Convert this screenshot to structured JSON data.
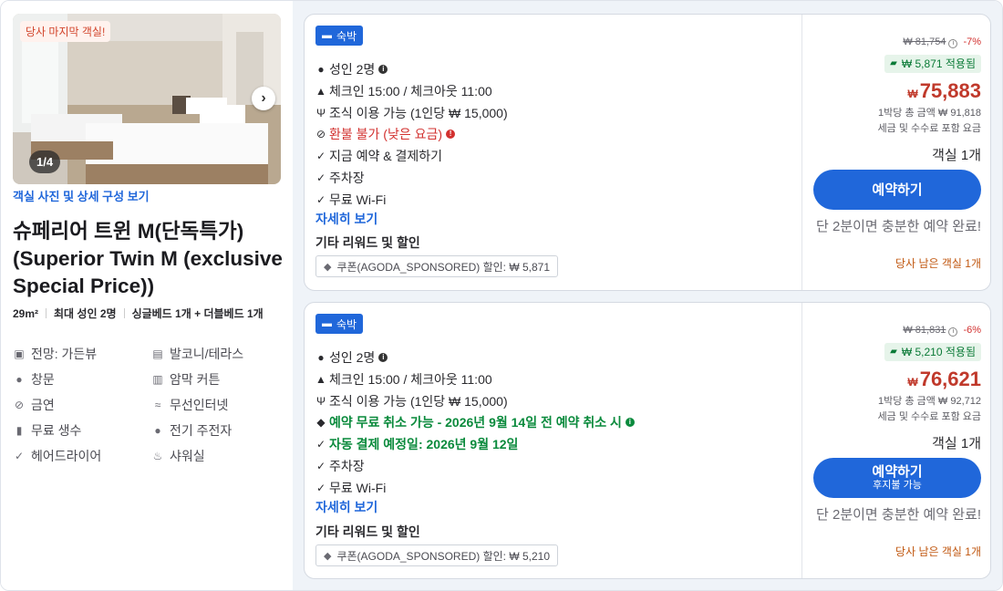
{
  "room": {
    "last_room_tag": "당사 마지막 객실!",
    "photo_counter": "1/4",
    "view_photos_link": "객실 사진 및 상세 구성 보기",
    "title": "슈페리어 트윈 M(단독특가) (Superior Twin M (exclusive Special Price))",
    "specs": {
      "size": "29m²",
      "occupancy": "최대 성인 2명",
      "beds": "싱글베드 1개 + 더블베드 1개"
    },
    "amenities": [
      {
        "icon": "view-icon",
        "label": "전망: 가든뷰"
      },
      {
        "icon": "balcony-icon",
        "label": "발코니/테라스"
      },
      {
        "icon": "window-icon",
        "label": "창문"
      },
      {
        "icon": "curtain-icon",
        "label": "암막 커튼"
      },
      {
        "icon": "no-smoking-icon",
        "label": "금연"
      },
      {
        "icon": "wifi-icon",
        "label": "무선인터넷"
      },
      {
        "icon": "water-bottle-icon",
        "label": "무료 생수"
      },
      {
        "icon": "ev-charger-icon",
        "label": "전기 주전자"
      },
      {
        "icon": "check-icon",
        "label": "헤어드라이어"
      },
      {
        "icon": "shower-icon",
        "label": "샤워실"
      }
    ]
  },
  "offers": [
    {
      "stay_tag": "숙박",
      "adults": "성인 2명",
      "checkin": "체크인 15:00 / 체크아웃 11:00",
      "breakfast": "조식 이용 가능 (1인당 ₩ 15,000)",
      "policy": "환불 불가 (낮은 요금)",
      "payment_note": "",
      "features": [
        "지금 예약 & 결제하기",
        "주차장",
        "무료 Wi-Fi"
      ],
      "details_link": "자세히 보기",
      "rewards_heading": "기타 리워드 및 할인",
      "coupon": "쿠폰(AGODA_SPONSORED) 할인: ₩ 5,871",
      "orig_price": "₩ 81,754",
      "discount_pct": "-7%",
      "applied": "₩ 5,871 적용됨",
      "currency": "₩",
      "final_price": "75,883",
      "total_line": "1박당 총 금액 ₩ 91,818",
      "tax_line": "세금 및 수수료 포함 요금",
      "rooms": "객실 1개",
      "book_label": "예약하기",
      "book_sub": "",
      "hurry": "단 2분이면 충분한 예약 완료!",
      "last_room": "당사 남은 객실 1개"
    },
    {
      "stay_tag": "숙박",
      "adults": "성인 2명",
      "checkin": "체크인 15:00 / 체크아웃 11:00",
      "breakfast": "조식 이용 가능 (1인당 ₩ 15,000)",
      "policy": "예약 무료 취소 가능 - 2026년 9월 14일 전 예약 취소 시",
      "payment_note": "자동 결제 예정일: 2026년 9월 12일",
      "features": [
        "주차장",
        "무료 Wi-Fi"
      ],
      "details_link": "자세히 보기",
      "rewards_heading": "기타 리워드 및 할인",
      "coupon": "쿠폰(AGODA_SPONSORED) 할인: ₩ 5,210",
      "orig_price": "₩ 81,831",
      "discount_pct": "-6%",
      "applied": "₩ 5,210 적용됨",
      "currency": "₩",
      "final_price": "76,621",
      "total_line": "1박당 총 금액 ₩ 92,712",
      "tax_line": "세금 및 수수료 포함 요금",
      "rooms": "객실 1개",
      "book_label": "예약하기",
      "book_sub": "후지불 가능",
      "hurry": "단 2분이면 충분한 예약 완료!",
      "last_room": "당사 남은 객실 1개"
    }
  ]
}
